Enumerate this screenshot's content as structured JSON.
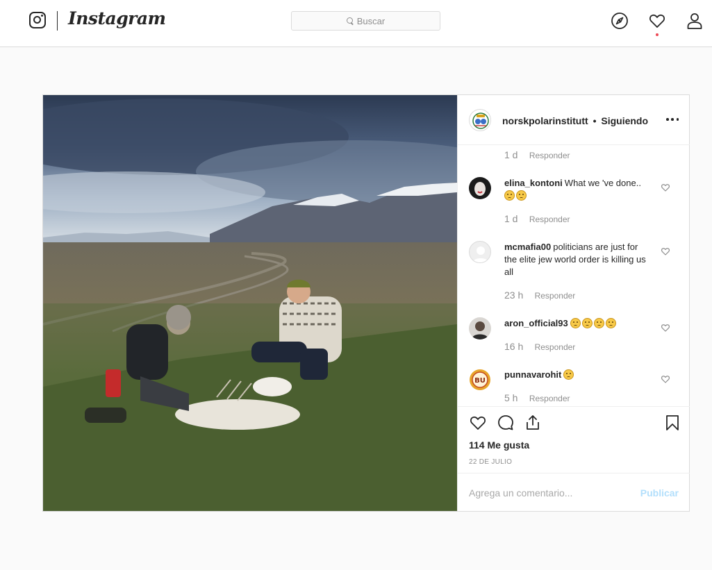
{
  "topbar": {
    "wordmark": "Instagram",
    "search_placeholder": "Buscar",
    "icons": [
      "instagram-glyph-icon",
      "search-icon",
      "explore-compass-icon",
      "activity-heart-icon",
      "profile-icon"
    ]
  },
  "post": {
    "owner": "norskpolarinstitutt",
    "separator": "•",
    "follow_state": "Siguiendo",
    "top_meta": {
      "age": "1 d",
      "reply": "Responder"
    },
    "comments": [
      {
        "user": "elina_kontoni",
        "text": "What we 've done..",
        "emoji_count": 2,
        "age": "1 d",
        "reply": "Responder"
      },
      {
        "user": "mcmafia00",
        "text": "politicians are just for the elite jew world order is killing us all",
        "emoji_count": 0,
        "age": "23 h",
        "reply": "Responder"
      },
      {
        "user": "aron_official93",
        "text": "",
        "emoji_count": 4,
        "age": "16 h",
        "reply": "Responder"
      },
      {
        "user": "punnavarohit",
        "text": "",
        "emoji_count": 1,
        "age": "5 h",
        "reply": "Responder"
      }
    ],
    "likes": "114 Me gusta",
    "date": "22 DE JULIO",
    "add_comment_placeholder": "Agrega un comentario...",
    "publish_label": "Publicar"
  },
  "colors": {
    "accent_blue_disabled": "#b2dffc",
    "notification_dot": "#ed4956",
    "border": "#dbdbdb",
    "muted_text": "#8e8e8e"
  }
}
